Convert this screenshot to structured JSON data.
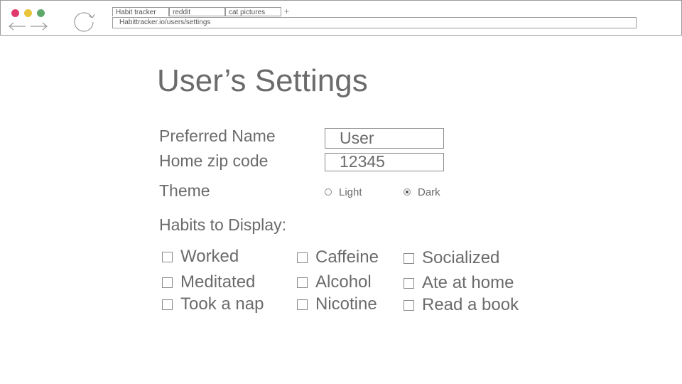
{
  "browser": {
    "tabs": [
      "Habit tracker",
      "reddit",
      "cat pictures"
    ],
    "new_tab": "+",
    "url": "Habittracker.io/users/settings"
  },
  "page": {
    "title": "User’s Settings"
  },
  "form": {
    "preferred_name_label": "Preferred Name",
    "preferred_name_value": "User",
    "zip_label": "Home zip code",
    "zip_value": "12345",
    "theme_label": "Theme",
    "theme_options": [
      "Light",
      "Dark"
    ],
    "theme_selected": "Dark",
    "habits_label": "Habits to Display:",
    "habits": [
      "Worked",
      "Caffeine",
      "Socialized",
      "Meditated",
      "Alcohol",
      "Ate at home",
      "Took a nap",
      "Nicotine",
      "Read a book"
    ]
  },
  "colors": {
    "close": "#e0396c",
    "minimize": "#e8c53a",
    "maximize": "#5fa86b",
    "text": "#6b6b6b"
  }
}
